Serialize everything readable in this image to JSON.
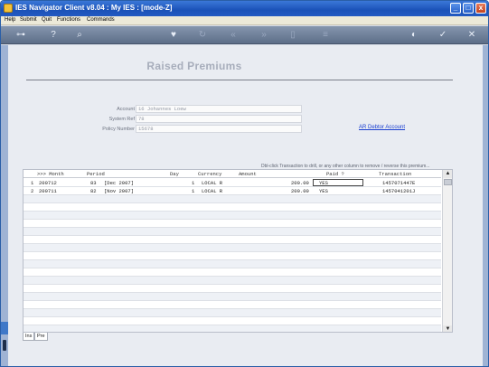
{
  "window": {
    "title": "IES Navigator Client v8.04 : My IES :     [mode-Z]",
    "controls": {
      "minimize": "_",
      "maximize": "□",
      "close": "x"
    }
  },
  "menubar": {
    "items": [
      "Help",
      "Submit",
      "Quit",
      "Functions",
      "Commands"
    ]
  },
  "toolbar": {
    "icons": [
      "key-icon",
      "help-icon",
      "search-icon",
      "heart-icon",
      "refresh-icon",
      "rewind-icon",
      "fast-forward-icon",
      "document-icon",
      "list-icon",
      "globe-icon",
      "check-icon",
      "close-icon"
    ]
  },
  "page": {
    "title": "Raised Premiums"
  },
  "form": {
    "account_label": "Account",
    "account_value": "16 Johannes Loew",
    "system_ref_label": "System Ref",
    "system_ref_value": "78",
    "policy_number_label": "Policy Number",
    "policy_number_value": "15678",
    "ar_link": "AR Debtor Account"
  },
  "hint": "Dbl-click Transaction to drill, or any other    column to remove / reverse this premium...",
  "grid": {
    "columns": {
      "month": ">>> Month",
      "period": "Period",
      "day": "Day",
      "currency": "Currency",
      "amount": "Amount",
      "paid": "Paid ?",
      "transaction": "Transaction"
    },
    "rows": [
      {
        "num": "1",
        "month": "200712",
        "period_num": "83",
        "period": "[Dec 2007]",
        "day": "1",
        "currency": "LOCAL R",
        "amount": "200.00",
        "paid": "YES",
        "transaction": "1457071447E"
      },
      {
        "num": "2",
        "month": "200711",
        "period_num": "82",
        "period": "[Nov 2007]",
        "day": "1",
        "currency": "LOCAL R",
        "amount": "200.00",
        "paid": "YES",
        "transaction": "1457041201J"
      }
    ]
  },
  "tabs": [
    "Ins",
    "Pre"
  ],
  "colors": {
    "titlebar": "#1b52b8",
    "toolbar": "#6b7c96",
    "link": "#1a3fd0"
  }
}
